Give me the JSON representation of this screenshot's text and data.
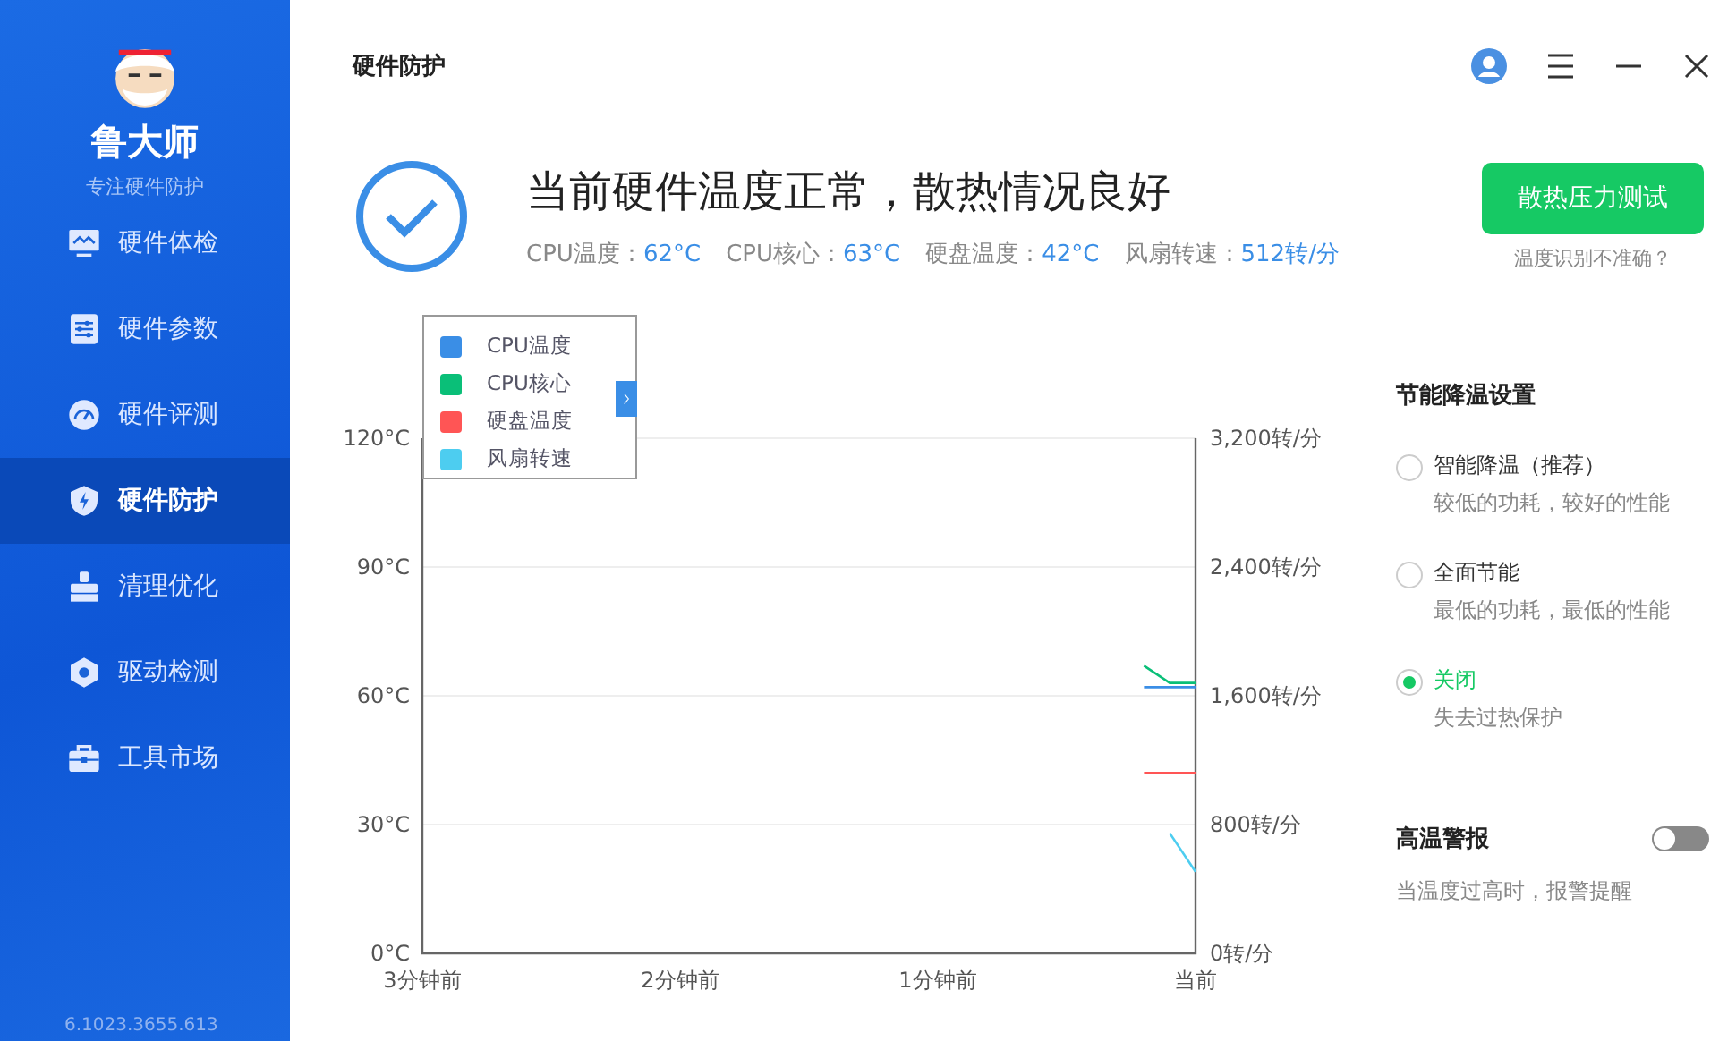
{
  "sidebar": {
    "brand": "鲁大师",
    "tagline": "专注硬件防护",
    "items": [
      {
        "label": "硬件体检",
        "selected": false
      },
      {
        "label": "硬件参数",
        "selected": false
      },
      {
        "label": "硬件评测",
        "selected": false
      },
      {
        "label": "硬件防护",
        "selected": true
      },
      {
        "label": "清理优化",
        "selected": false
      },
      {
        "label": "驱动检测",
        "selected": false
      },
      {
        "label": "工具市场",
        "selected": false
      }
    ],
    "version": "6.1023.3655.613"
  },
  "header": {
    "title": "硬件防护"
  },
  "status": {
    "headline": "当前硬件温度正常，散热情况良好",
    "readings": [
      {
        "label": "CPU温度：",
        "value": "62°C"
      },
      {
        "label": "CPU核心：",
        "value": "63°C"
      },
      {
        "label": "硬盘温度：",
        "value": "42°C"
      },
      {
        "label": "风扇转速：",
        "value": "512转/分"
      }
    ],
    "button": "散热压力测试",
    "link": "温度识别不准确？"
  },
  "chart": {
    "right_axis_labels": [
      "3,200转/分",
      "2,400转/分",
      "1,600转/分",
      "800转/分",
      "0转/分"
    ],
    "chart_data": {
      "type": "line",
      "categories": [
        "3分钟前",
        null,
        null,
        null,
        null,
        null,
        null,
        null,
        null,
        null,
        "2分钟前",
        null,
        null,
        null,
        null,
        null,
        null,
        null,
        null,
        null,
        "1分钟前",
        null,
        null,
        null,
        null,
        null,
        null,
        null,
        null,
        null,
        "当前"
      ],
      "ylim": [
        0,
        120
      ],
      "grid": true,
      "legend": "top-left",
      "yticks": [
        {
          "value": 0,
          "label": "0°C"
        },
        {
          "value": 30,
          "label": "30°C"
        },
        {
          "value": 60,
          "label": "60°C"
        },
        {
          "value": 90,
          "label": "90°C"
        },
        {
          "value": 120,
          "label": "120°C"
        }
      ],
      "series": [
        {
          "name": "CPU温度",
          "color": "#3a8ee6",
          "values": [
            null,
            null,
            null,
            null,
            null,
            null,
            null,
            null,
            null,
            null,
            null,
            null,
            null,
            null,
            null,
            null,
            null,
            null,
            null,
            null,
            null,
            null,
            null,
            null,
            null,
            null,
            null,
            null,
            62,
            62,
            62
          ]
        },
        {
          "name": "CPU核心",
          "color": "#0abf78",
          "values": [
            null,
            null,
            null,
            null,
            null,
            null,
            null,
            null,
            null,
            null,
            null,
            null,
            null,
            null,
            null,
            null,
            null,
            null,
            null,
            null,
            null,
            null,
            null,
            null,
            null,
            null,
            null,
            null,
            67,
            63,
            63
          ]
        },
        {
          "name": "硬盘温度",
          "color": "#ff5555",
          "values": [
            null,
            null,
            null,
            null,
            null,
            null,
            null,
            null,
            null,
            null,
            null,
            null,
            null,
            null,
            null,
            null,
            null,
            null,
            null,
            null,
            null,
            null,
            null,
            null,
            null,
            null,
            null,
            null,
            42,
            42,
            42
          ]
        },
        {
          "name": "风扇转速",
          "color": "#4dcdf0",
          "values": [
            null,
            null,
            null,
            null,
            null,
            null,
            null,
            null,
            null,
            null,
            null,
            null,
            null,
            null,
            null,
            null,
            null,
            null,
            null,
            null,
            null,
            null,
            null,
            null,
            null,
            null,
            null,
            null,
            null,
            28,
            19
          ]
        }
      ]
    }
  },
  "settings": {
    "title": "节能降温设置",
    "options": [
      {
        "label": "智能降温（推荐）",
        "description": "较低的功耗，较好的性能",
        "selected": false
      },
      {
        "label": "全面节能",
        "description": "最低的功耗，最低的性能",
        "selected": false
      },
      {
        "label": "关闭",
        "description": "失去过热保护",
        "selected": true
      }
    ],
    "alert": {
      "label": "高温警报",
      "description": "当温度过高时，报警提醒",
      "on": false
    }
  }
}
